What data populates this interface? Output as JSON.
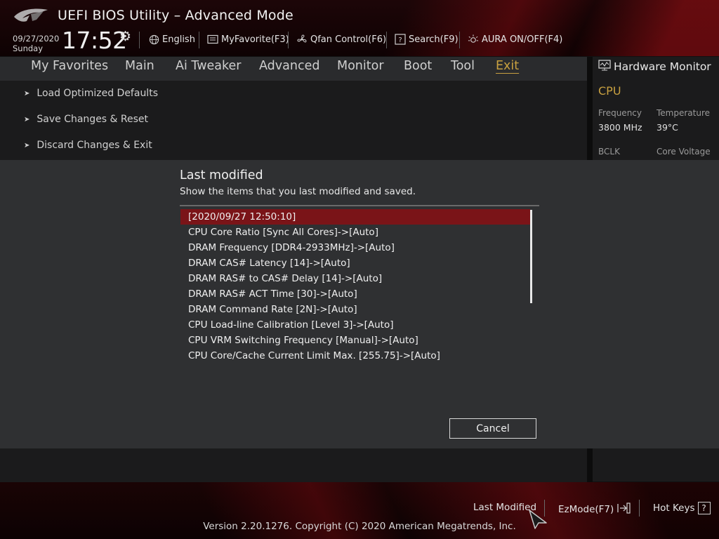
{
  "header": {
    "title": "UEFI BIOS Utility – Advanced Mode",
    "date": "09/27/2020",
    "day": "Sunday",
    "time": "17:52",
    "items": [
      {
        "label": "English",
        "icon": "globe-icon"
      },
      {
        "label": "MyFavorite(F3)",
        "icon": "favorite-icon"
      },
      {
        "label": "Qfan Control(F6)",
        "icon": "fan-icon"
      },
      {
        "label": "Search(F9)",
        "icon": "search-help-icon"
      },
      {
        "label": "AURA ON/OFF(F4)",
        "icon": "aura-icon"
      }
    ]
  },
  "nav": {
    "tabs": [
      "My Favorites",
      "Main",
      "Ai Tweaker",
      "Advanced",
      "Monitor",
      "Boot",
      "Tool",
      "Exit"
    ],
    "active": "Exit"
  },
  "main": {
    "items": [
      "Load Optimized Defaults",
      "Save Changes & Reset",
      "Discard Changes & Exit"
    ]
  },
  "hardware_monitor": {
    "title": "Hardware Monitor",
    "section": "CPU",
    "frequency_label": "Frequency",
    "frequency_value": "3800 MHz",
    "temperature_label": "Temperature",
    "temperature_value": "39°C",
    "bclk_label": "BCLK",
    "core_voltage_label": "Core Voltage"
  },
  "modal": {
    "title": "Last modified",
    "subtitle": "Show the items that you last modified and saved.",
    "entries": [
      "[2020/09/27 12:50:10]",
      "CPU Core Ratio [Sync All Cores]->[Auto]",
      "DRAM Frequency [DDR4-2933MHz]->[Auto]",
      "DRAM CAS# Latency [14]->[Auto]",
      "DRAM RAS# to CAS# Delay [14]->[Auto]",
      "DRAM RAS# ACT Time [30]->[Auto]",
      "DRAM Command Rate [2N]->[Auto]",
      "CPU Load-line Calibration [Level 3]->[Auto]",
      "CPU VRM Switching Frequency [Manual]->[Auto]",
      "CPU Core/Cache Current Limit Max. [255.75]->[Auto]"
    ],
    "cancel_label": "Cancel"
  },
  "footer": {
    "last_modified": "Last Modified",
    "ezmode": "EzMode(F7)",
    "hot_keys": "Hot Keys",
    "hot_keys_icon": "?",
    "version": "Version 2.20.1276. Copyright (C) 2020 American Megatrends, Inc."
  },
  "colors": {
    "accent_gold": "#c8a040",
    "selected_row": "#7a1418",
    "modal_bg": "#2f3032"
  }
}
